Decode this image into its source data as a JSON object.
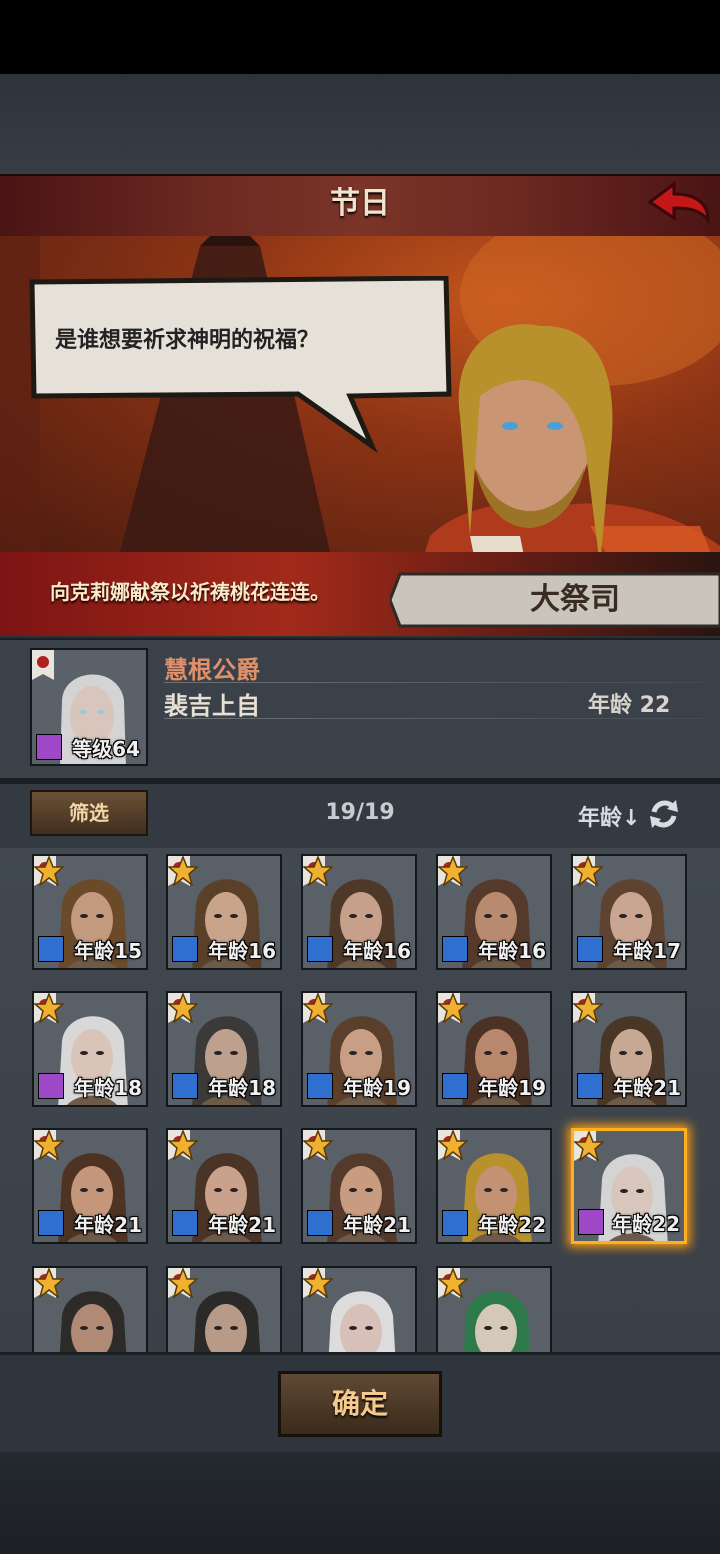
{
  "header": {
    "title": "节日",
    "back_icon": "back-arrow-icon"
  },
  "dialog": {
    "speech": "是谁想要祈求神明的祝福？",
    "description": "向克莉娜献祭以祈祷桃花连连。",
    "npc_name": "大祭司"
  },
  "selected": {
    "title": "慧根公爵",
    "name": "裴吉上自",
    "age_label": "年龄 22",
    "level_label": "等级64",
    "class_icon": "staff-icon"
  },
  "filter": {
    "button": "筛选",
    "count": "19/19",
    "sort_label": "年龄↓",
    "sort_icon": "refresh-icon"
  },
  "characters": [
    {
      "age": "年龄15",
      "cls": "blue",
      "hair": "#6b4a2a",
      "skin": "#c49a7e"
    },
    {
      "age": "年龄16",
      "cls": "blue",
      "hair": "#5a4028",
      "skin": "#c9a48a"
    },
    {
      "age": "年龄16",
      "cls": "blue",
      "hair": "#4e3828",
      "skin": "#c6a08a"
    },
    {
      "age": "年龄16",
      "cls": "blue",
      "hair": "#55392a",
      "skin": "#b88a70"
    },
    {
      "age": "年龄17",
      "cls": "blue",
      "hair": "#5e4330",
      "skin": "#caa592"
    },
    {
      "age": "年龄18",
      "cls": "purple",
      "hair": "#d8d8d8",
      "skin": "#d9c4b8"
    },
    {
      "age": "年龄18",
      "cls": "blue",
      "hair": "#3b3a38",
      "skin": "#bda08e"
    },
    {
      "age": "年龄19",
      "cls": "blue",
      "hair": "#5a3f2a",
      "skin": "#c89e84"
    },
    {
      "age": "年龄19",
      "cls": "blue",
      "hair": "#4b3224",
      "skin": "#b8876c"
    },
    {
      "age": "年龄21",
      "cls": "blue",
      "hair": "#4a3626",
      "skin": "#c7a894"
    },
    {
      "age": "年龄21",
      "cls": "blue",
      "hair": "#4e3222",
      "skin": "#c4977a"
    },
    {
      "age": "年龄21",
      "cls": "blue",
      "hair": "#4a3426",
      "skin": "#caa18a"
    },
    {
      "age": "年龄21",
      "cls": "blue",
      "hair": "#55392a",
      "skin": "#c89c80"
    },
    {
      "age": "年龄22",
      "cls": "blue",
      "hair": "#b8902c",
      "skin": "#c29272"
    },
    {
      "age": "年龄22",
      "cls": "purple",
      "hair": "#d4d4d4",
      "skin": "#d8c6bc"
    },
    {
      "age": "",
      "cls": "",
      "hair": "#2e2a28",
      "skin": "#b08a74"
    },
    {
      "age": "",
      "cls": "",
      "hair": "#2c2a28",
      "skin": "#b89a88"
    },
    {
      "age": "",
      "cls": "",
      "hair": "#dcdcdc",
      "skin": "#d6c0b8"
    },
    {
      "age": "",
      "cls": "",
      "hair": "#2f7a4a",
      "skin": "#d6c8b8"
    }
  ],
  "confirm_label": "确定",
  "colors": {
    "accent": "#ffb020",
    "title_text": "#e0906a",
    "button_text": "#f6c98c"
  }
}
